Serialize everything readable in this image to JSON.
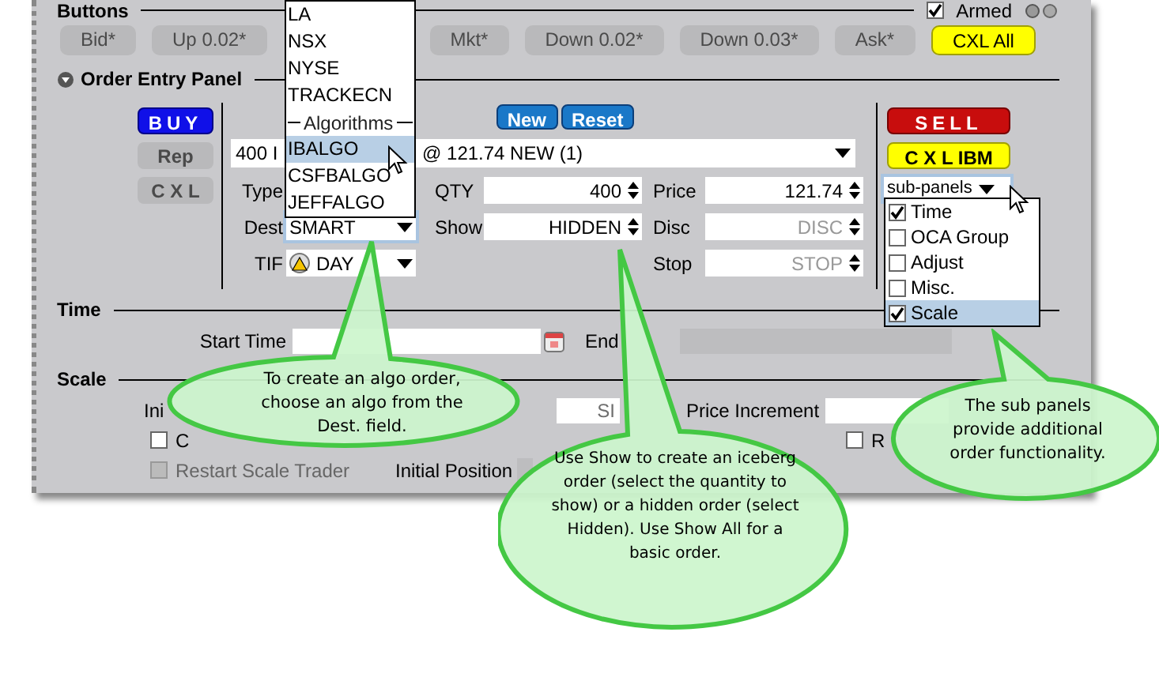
{
  "buttons_section": {
    "title": "Buttons",
    "armed": {
      "label": "Armed",
      "checked": true
    },
    "buttons": [
      {
        "label": "Bid*",
        "kind": "plain"
      },
      {
        "label": "Up 0.02*",
        "kind": "plain"
      },
      {
        "label": "Mkt*",
        "kind": "plain"
      },
      {
        "label": "Down 0.02*",
        "kind": "plain"
      },
      {
        "label": "Down 0.03*",
        "kind": "plain"
      },
      {
        "label": "Ask*",
        "kind": "plain"
      },
      {
        "label": "CXL All",
        "kind": "yellow"
      }
    ]
  },
  "order_entry": {
    "title": "Order Entry Panel",
    "expanded": true,
    "side_buttons": [
      {
        "label": "BUY",
        "kind": "blue"
      },
      {
        "label": "Rep",
        "kind": "plain"
      },
      {
        "label": "C X L",
        "kind": "plain"
      }
    ],
    "top_buttons": [
      {
        "label": "New"
      },
      {
        "label": "Reset"
      }
    ],
    "order_line": [
      "400 I",
      "@ 121.74 NEW (1)"
    ],
    "rows": [
      {
        "fields": [
          {
            "label": "Type",
            "kind": "select"
          },
          {
            "label": "QTY",
            "kind": "spinner",
            "value": "400"
          },
          {
            "label": "Price",
            "kind": "spinner",
            "value": "121.74"
          }
        ]
      },
      {
        "fields": [
          {
            "label": "Dest",
            "kind": "select",
            "value": "SMART",
            "focused": true
          },
          {
            "label": "Show",
            "kind": "spinner",
            "value": "HIDDEN"
          },
          {
            "label": "Disc",
            "kind": "spinner",
            "placeholder": "DISC"
          }
        ]
      },
      {
        "fields": [
          {
            "label": "TIF",
            "kind": "select",
            "value": "DAY",
            "warning": true
          },
          {
            "kind": "blank"
          },
          {
            "label": "Stop",
            "kind": "spinner",
            "placeholder": "STOP"
          }
        ]
      }
    ],
    "right_buttons": [
      {
        "label": "SELL",
        "kind": "red"
      },
      {
        "label": "C X L IBM",
        "kind": "yellow"
      }
    ],
    "sub_panels": {
      "label": "sub-panels",
      "items": [
        {
          "label": "Time",
          "checked": true,
          "selected": false
        },
        {
          "label": "OCA Group",
          "checked": false,
          "selected": false
        },
        {
          "label": "Adjust",
          "checked": false,
          "selected": false
        },
        {
          "label": "Misc.",
          "checked": false,
          "selected": false
        },
        {
          "label": "Scale",
          "checked": true,
          "selected": true
        }
      ]
    }
  },
  "dest_menu": {
    "items": [
      {
        "label": "LA",
        "kind": "item",
        "selected": false
      },
      {
        "label": "NSX",
        "kind": "item",
        "selected": false
      },
      {
        "label": "NYSE",
        "kind": "item",
        "selected": false
      },
      {
        "label": "TRACKECN",
        "kind": "item",
        "selected": false
      },
      {
        "label": "Algorithms",
        "kind": "header"
      },
      {
        "label": "IBALGO",
        "kind": "item",
        "selected": true
      },
      {
        "label": "CSFBALGO",
        "kind": "item",
        "selected": false
      },
      {
        "label": "JEFFALGO",
        "kind": "item",
        "selected": false
      }
    ]
  },
  "time_section": {
    "title": "Time",
    "start_label": "Start Time",
    "end_label": "End"
  },
  "scale_section": {
    "title": "Scale",
    "row1": {
      "label": "Ini",
      "field_placeholder": "SI",
      "increment_label": "Price Increment"
    },
    "row2": [
      {
        "label": "C",
        "checked": false,
        "disabled": false
      },
      {
        "label": "R",
        "checked": false,
        "disabled": false
      }
    ],
    "row3": {
      "check": {
        "label": "Restart Scale Trader",
        "checked": false,
        "disabled": true
      },
      "position_label": "Initial Position"
    }
  },
  "callouts": [
    {
      "text": "To create an algo order, choose an algo from the Dest. field."
    },
    {
      "text": "Use Show to create an iceberg order (select the quantity to show) or a hidden order (select Hidden). Use Show All for a basic order."
    },
    {
      "text": "The sub panels provide additional order functionality."
    }
  ]
}
